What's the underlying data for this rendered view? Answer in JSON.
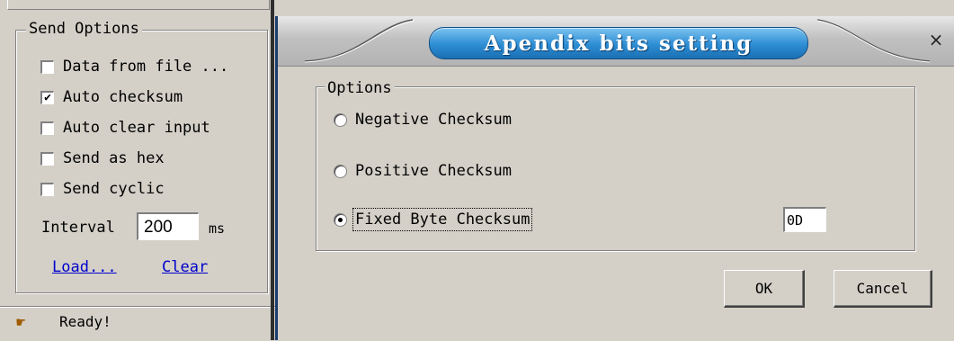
{
  "send_options": {
    "title": "Send Options",
    "items": [
      {
        "label": "Data from file ...",
        "checked": false
      },
      {
        "label": "Auto checksum",
        "checked": true
      },
      {
        "label": "Auto clear input",
        "checked": false
      },
      {
        "label": "Send as hex",
        "checked": false
      },
      {
        "label": "Send cyclic",
        "checked": false
      }
    ],
    "interval_label": "Interval",
    "interval_value": "200",
    "interval_unit": "ms",
    "load_link": "Load...",
    "clear_link": "Clear"
  },
  "status": {
    "text": "Ready!",
    "icon": "pointing-hand-icon",
    "check_glyph": "✔"
  },
  "dialog": {
    "title": "Apendix bits setting",
    "close_label": "×",
    "group_title": "Options",
    "options": [
      {
        "label": "Negative Checksum",
        "selected": false
      },
      {
        "label": "Positive Checksum",
        "selected": false
      },
      {
        "label": "Fixed Byte Checksum",
        "selected": true
      }
    ],
    "fixed_byte_value": "0D",
    "ok_label": "OK",
    "cancel_label": "Cancel"
  },
  "colors": {
    "window_bg": "#d4d0c8",
    "title_accent": "#2d8dd4",
    "link": "#0000cc"
  }
}
